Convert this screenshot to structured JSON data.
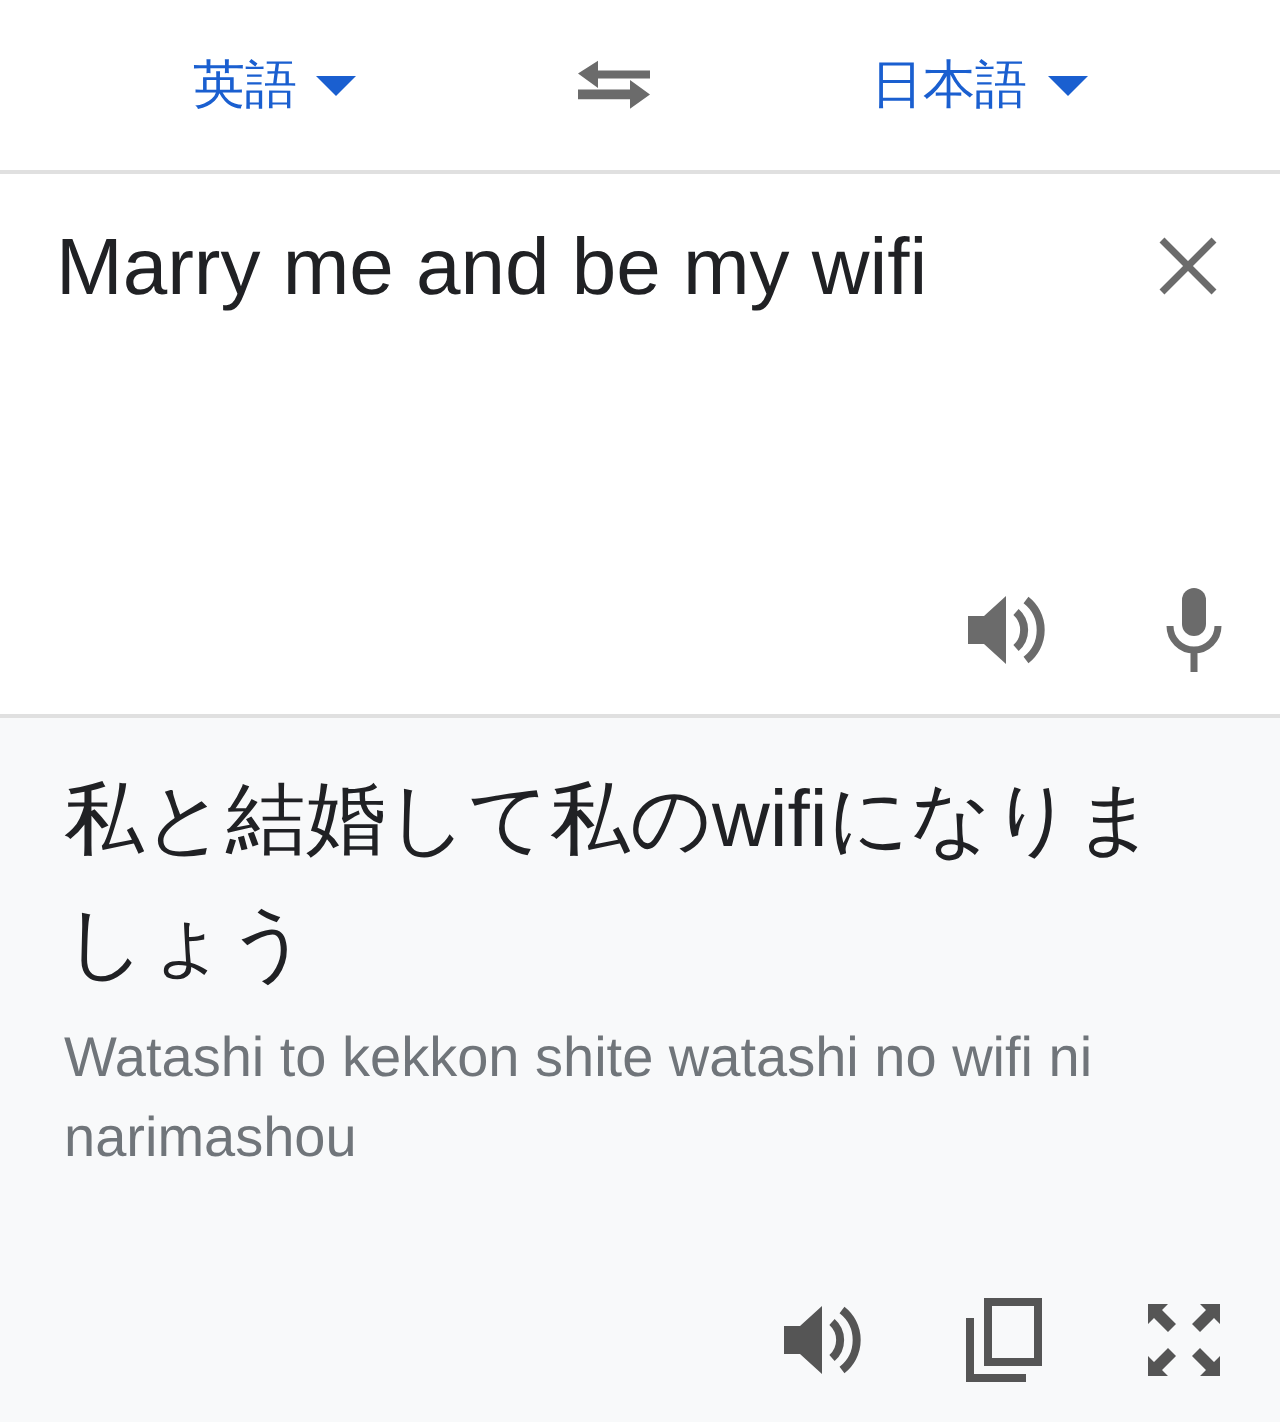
{
  "languages": {
    "source": "英語",
    "target": "日本語"
  },
  "input": {
    "value": "Marry me and be my wifi"
  },
  "output": {
    "translation": "私と結婚して私のwifiになりましょう",
    "romanization": "Watashi to kekkon shite watashi no wifi ni narimashou"
  }
}
